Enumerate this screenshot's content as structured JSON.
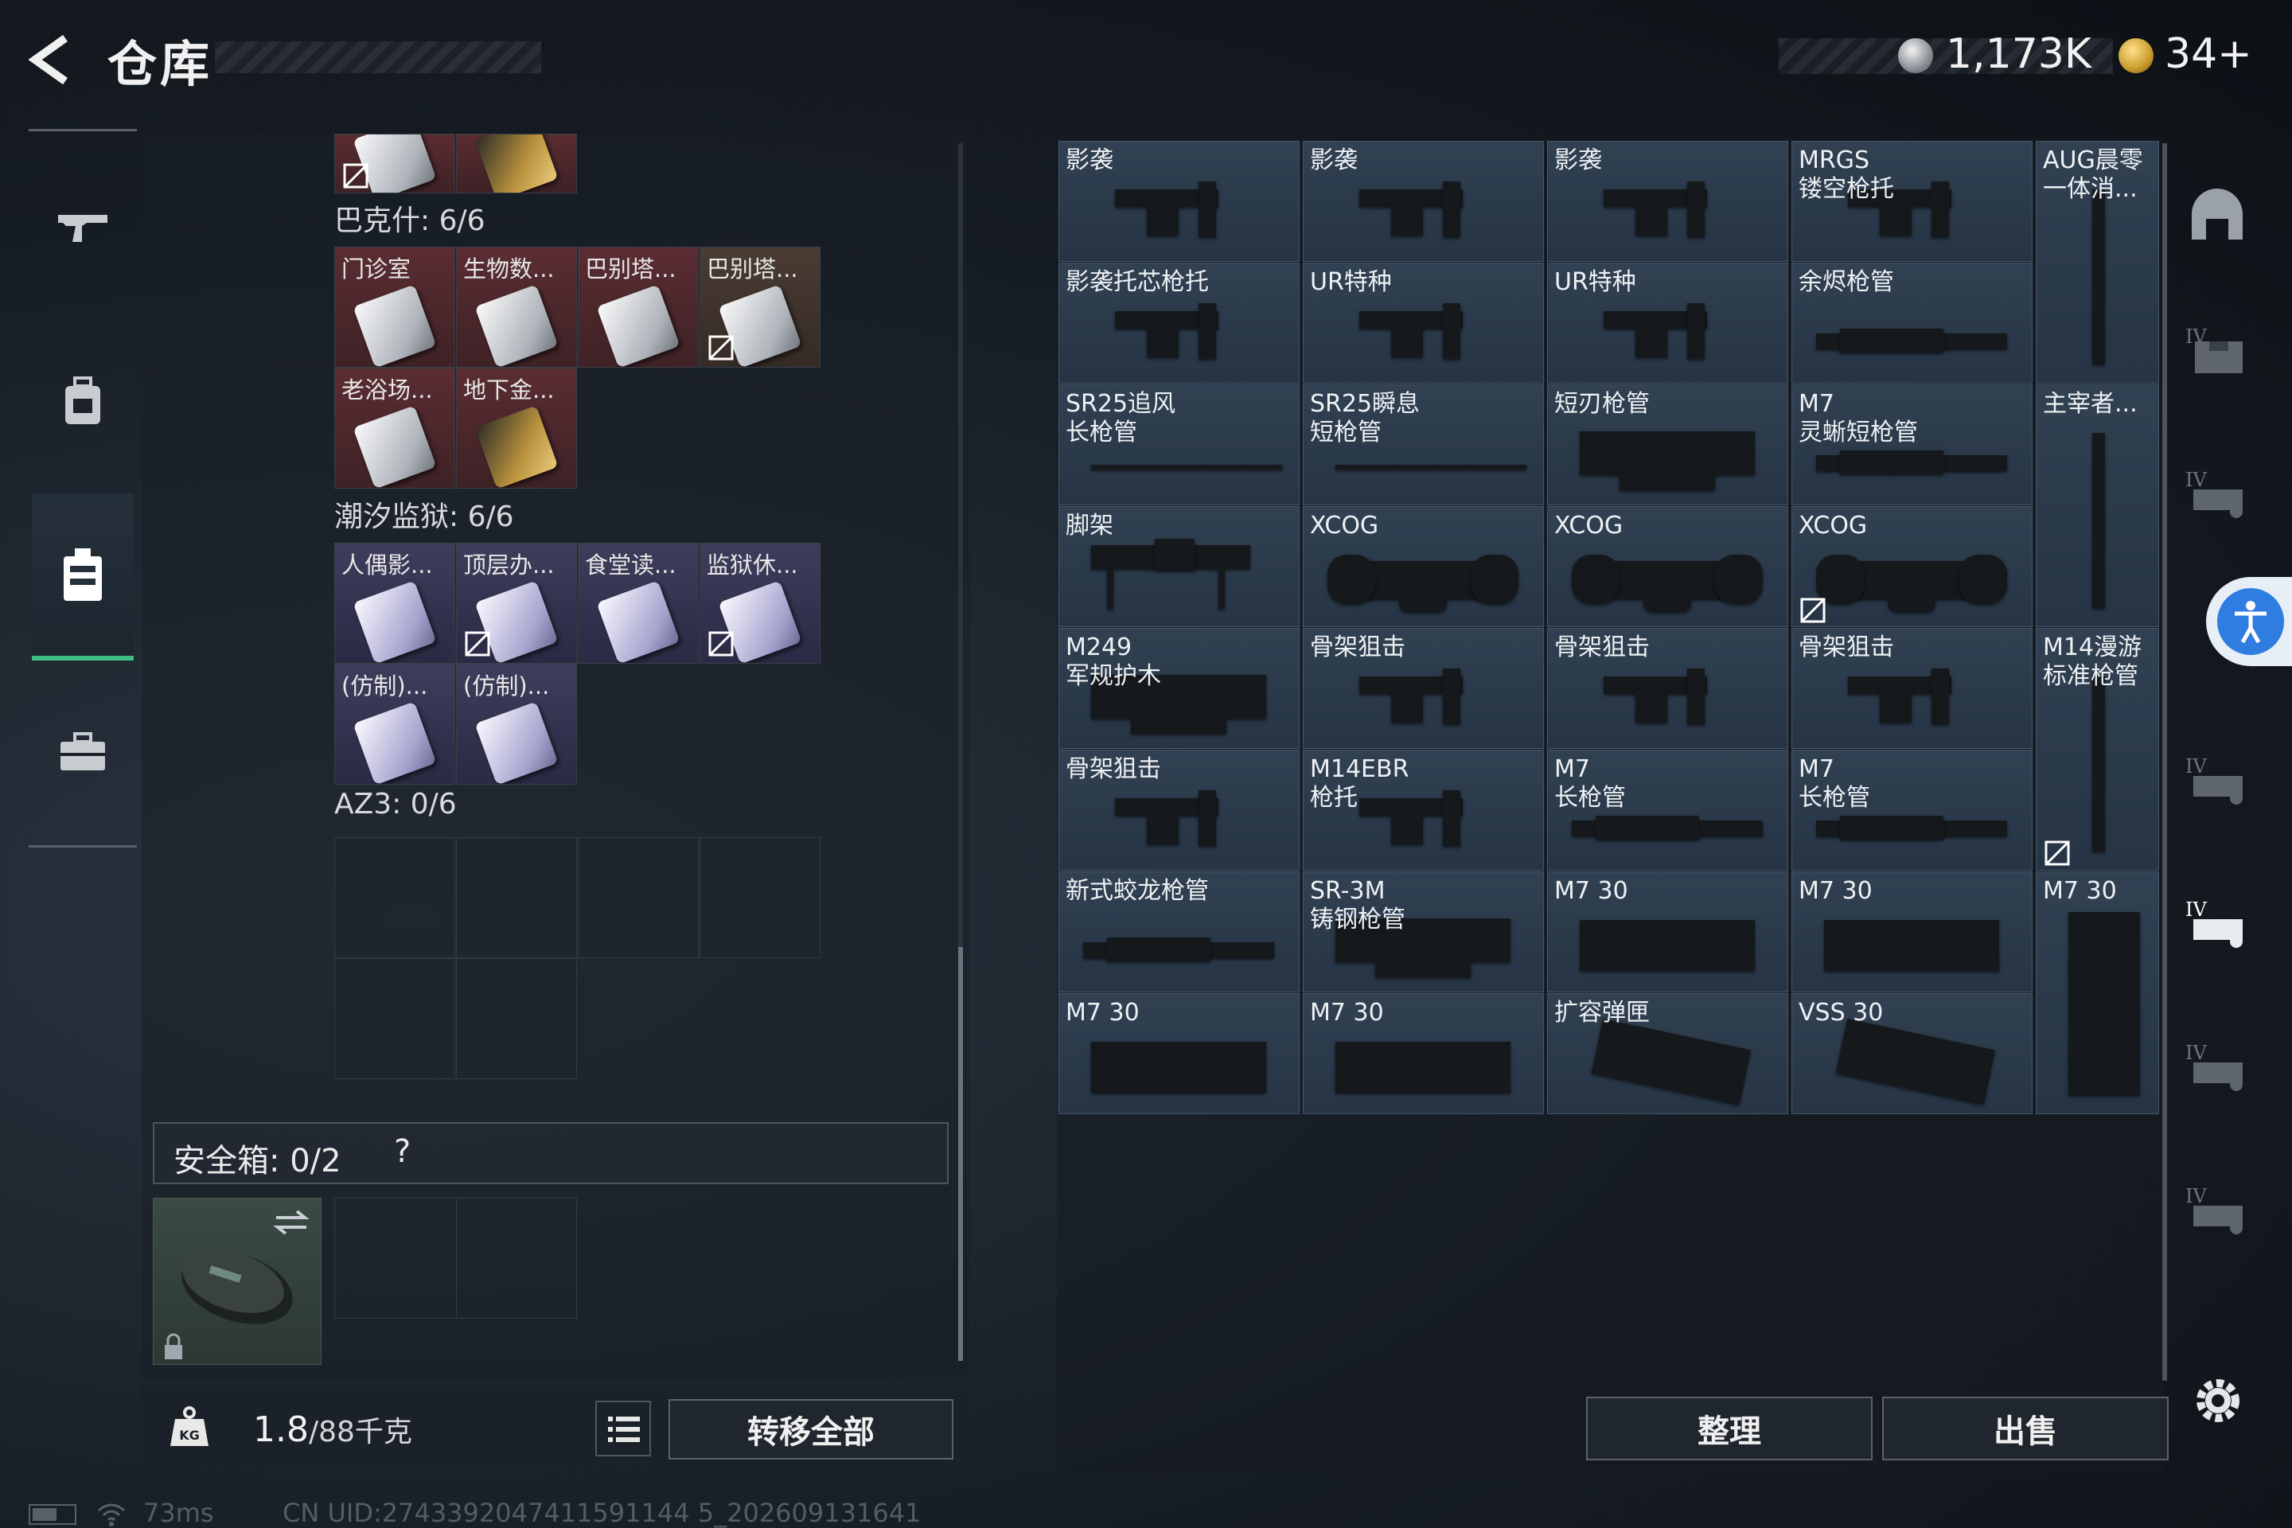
{
  "header": {
    "title": "仓库",
    "currency_silver": "1,173K",
    "currency_gold": "34+"
  },
  "left_nav": [
    "weapon-tab",
    "backpack-tab",
    "locker-tab",
    "briefcase-tab"
  ],
  "keys": {
    "groups": [
      {
        "title": "巴克什: 6/6",
        "items": [
          {
            "label": "门诊室",
            "color": "red"
          },
          {
            "label": "生物数...",
            "color": "red"
          },
          {
            "label": "巴别塔...",
            "color": "red"
          },
          {
            "label": "巴别塔...",
            "color": "brown",
            "not_sellable": true
          },
          {
            "label": "老浴场...",
            "color": "red"
          },
          {
            "label": "地下金...",
            "color": "red",
            "gold": true
          }
        ]
      },
      {
        "title": "潮汐监狱: 6/6",
        "items": [
          {
            "label": "人偶影...",
            "color": "purple"
          },
          {
            "label": "顶层办...",
            "color": "purple",
            "not_sellable": true
          },
          {
            "label": "食堂读...",
            "color": "purple"
          },
          {
            "label": "监狱休...",
            "color": "purple",
            "not_sellable": true
          },
          {
            "label": "(仿制)...",
            "color": "purple"
          },
          {
            "label": "(仿制)...",
            "color": "purple"
          }
        ]
      },
      {
        "title": "AZ3: 0/6",
        "items": []
      }
    ]
  },
  "safe_box": {
    "label": "安全箱: 0/2",
    "help": "?"
  },
  "capacity": {
    "current": "1.8",
    "max": "/88千克",
    "unit_icon": "KG"
  },
  "buttons": {
    "transfer_all": "转移全部",
    "sort": "整理",
    "sell": "出售"
  },
  "status": {
    "ping": "73ms",
    "uid": "CN UID:2743392047411591144 5_202609131641"
  },
  "inventory": {
    "items": [
      {
        "label": "影袭",
        "kind": "stock"
      },
      {
        "label": "影袭",
        "kind": "stock"
      },
      {
        "label": "影袭",
        "kind": "stock"
      },
      {
        "label": "MRGS\n镂空枪托",
        "kind": "stock"
      },
      {
        "label": "AUG晨零\n一体消...",
        "kind": "tall-barrel"
      },
      {
        "label": "影袭托芯枪托",
        "kind": "stock"
      },
      {
        "label": "UR特种",
        "kind": "stock"
      },
      {
        "label": "UR特种",
        "kind": "stock"
      },
      {
        "label": "余烬枪管",
        "kind": "barrel"
      },
      {
        "label": "SR25追风\n长枪管",
        "kind": "thin-barrel"
      },
      {
        "label": "SR25瞬息\n短枪管",
        "kind": "thin-barrel"
      },
      {
        "label": "短刃枪管",
        "kind": "handguard"
      },
      {
        "label": "M7\n灵蜥短枪管",
        "kind": "barrel"
      },
      {
        "label": "主宰者...",
        "kind": "tall-barrel"
      },
      {
        "label": "脚架",
        "kind": "bipod"
      },
      {
        "label": "XCOG",
        "kind": "scope"
      },
      {
        "label": "XCOG",
        "kind": "scope"
      },
      {
        "label": "XCOG",
        "kind": "scope",
        "not_sellable": true
      },
      {
        "label": "M249\n军规护木",
        "kind": "handguard"
      },
      {
        "label": "骨架狙击",
        "kind": "stock"
      },
      {
        "label": "骨架狙击",
        "kind": "stock"
      },
      {
        "label": "骨架狙击",
        "kind": "stock"
      },
      {
        "label": "M14漫游\n标准枪管",
        "kind": "tall-barrel",
        "not_sellable": true
      },
      {
        "label": "骨架狙击",
        "kind": "stock"
      },
      {
        "label": "M14EBR\n枪托",
        "kind": "stock"
      },
      {
        "label": "M7\n长枪管",
        "kind": "barrel"
      },
      {
        "label": "M7\n长枪管",
        "kind": "barrel"
      },
      {
        "label": "新式蛟龙枪管",
        "kind": "barrel"
      },
      {
        "label": "SR-3M\n铸钢枪管",
        "kind": "handguard"
      },
      {
        "label": "M7 30",
        "kind": "mag"
      },
      {
        "label": "M7 30",
        "kind": "mag"
      },
      {
        "label": "M7 30",
        "kind": "tall-mag"
      },
      {
        "label": "M7 30",
        "kind": "mag"
      },
      {
        "label": "M7 30",
        "kind": "mag"
      },
      {
        "label": "扩容弹匣",
        "kind": "curved-mag"
      },
      {
        "label": "VSS 30",
        "kind": "curved-mag"
      }
    ]
  },
  "right_filters": [
    "helmet-filter",
    "armor-filter",
    "backpack-filter",
    "vest-filter",
    "item-filter",
    "item-filter-active",
    "item-filter",
    "item-filter",
    "more-filter"
  ],
  "colors": {
    "accent_green": "#3fbf86",
    "key_red": "#5a2d32",
    "key_purple": "#3e3d5c",
    "grid_blue": "#314152"
  }
}
